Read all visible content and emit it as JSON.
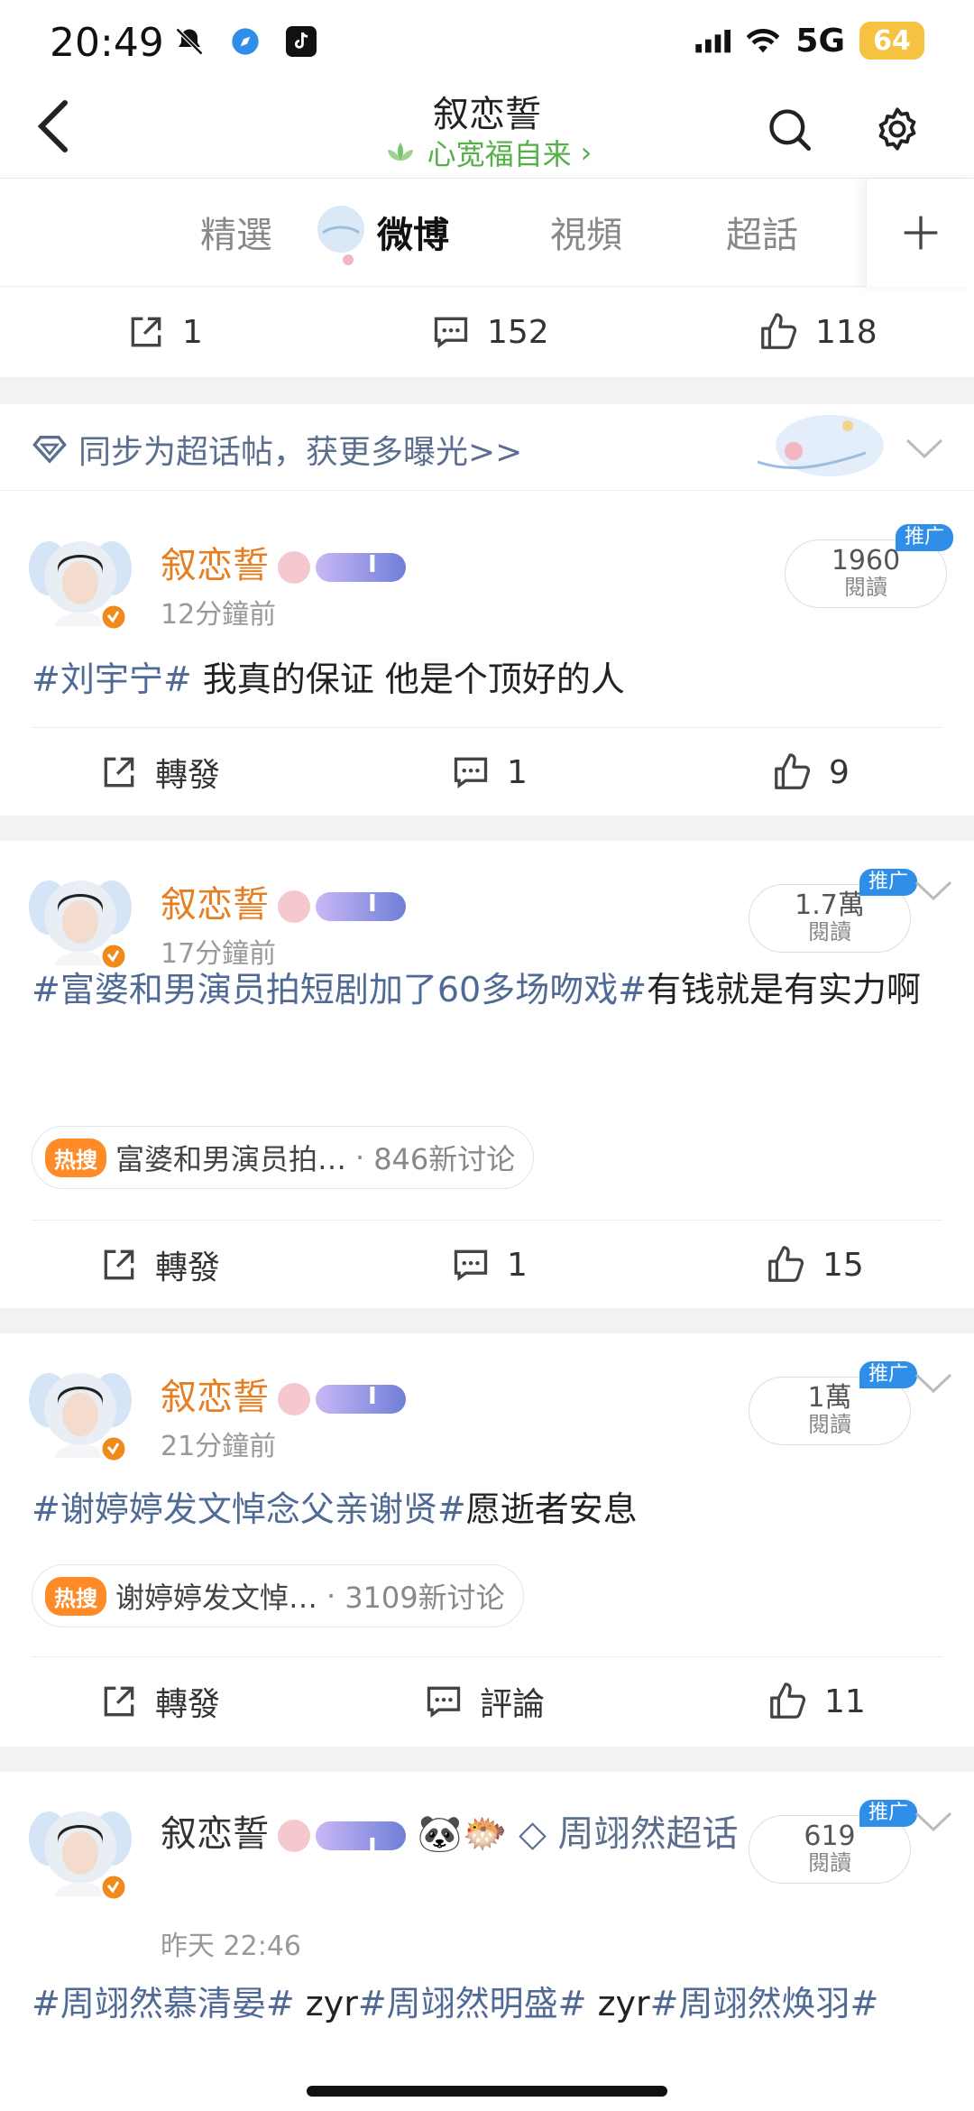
{
  "status": {
    "time": "20:49",
    "network": "5G",
    "battery": "64"
  },
  "header": {
    "title": "叙恋誓",
    "subtitle": "心宽福自来"
  },
  "tabs": [
    {
      "label": "精選"
    },
    {
      "label": "微博"
    },
    {
      "label": "視頻"
    },
    {
      "label": "超話"
    }
  ],
  "top_actions": {
    "repost": "1",
    "comments": "152",
    "likes": "118"
  },
  "sync_banner": {
    "text": "同步为超话帖，获更多曝光>>"
  },
  "posts": [
    {
      "author": "叙恋誓",
      "time": "12分鐘前",
      "reads_value": "1960",
      "reads_label": "閱讀",
      "promo": "推广",
      "text_hash": "#刘宇宁#",
      "text_body": " 我真的保证  他是个顶好的人",
      "repost_label": "轉發",
      "comments": "1",
      "likes": "9"
    },
    {
      "author": "叙恋誓",
      "time": "17分鐘前",
      "reads_value": "1.7萬",
      "reads_label": "閱讀",
      "promo": "推广",
      "text_hash": "#富婆和男演员拍短剧加了60多场吻戏#",
      "text_body": "有钱就是有实力啊",
      "hot_tag": "热搜",
      "hot_title": "富婆和男演员拍…",
      "hot_count": "846新讨论",
      "repost_label": "轉發",
      "comments": "1",
      "likes": "15"
    },
    {
      "author": "叙恋誓",
      "time": "21分鐘前",
      "reads_value": "1萬",
      "reads_label": "閱讀",
      "promo": "推广",
      "text_hash": "#谢婷婷发文悼念父亲谢贤#",
      "text_body": "愿逝者安息",
      "hot_tag": "热搜",
      "hot_title": "谢婷婷发文悼…",
      "hot_count": "3109新讨论",
      "repost_label": "轉發",
      "comments_label": "評論",
      "likes": "11"
    },
    {
      "author": "叙恋誓",
      "topic": "周翊然超话",
      "time": "昨天 22:46",
      "reads_value": "619",
      "reads_label": "閱讀",
      "promo": "推广",
      "text_a": "#周翊然慕清晏#",
      "text_b": " zyr",
      "text_c": "#周翊然明盛#",
      "text_d": " zyr",
      "text_e": "#周翊然焕羽#"
    }
  ],
  "icons": {
    "back": "chevron-left-icon",
    "search": "search-icon",
    "settings": "gear-icon",
    "add": "plus-icon",
    "repost": "share-icon",
    "comment": "comment-icon",
    "like": "thumb-up-icon"
  },
  "colors": {
    "accent_green": "#55b04a",
    "author_orange": "#e67e22",
    "hashtag_blue": "#506a96",
    "promo_blue": "#2f8fe8"
  }
}
